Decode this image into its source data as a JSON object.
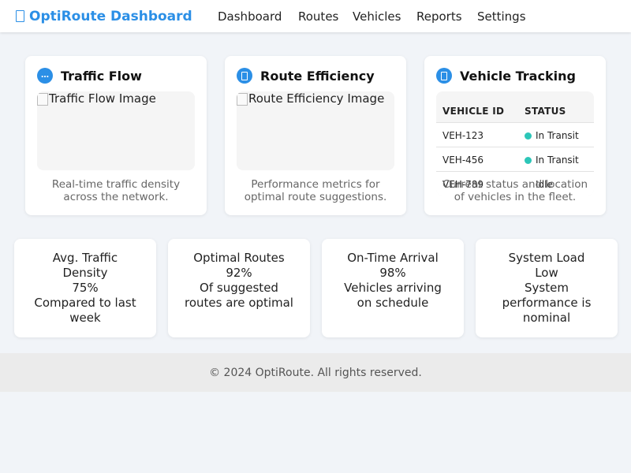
{
  "header": {
    "brand": "OptiRoute Dashboard",
    "nav": [
      "Dashboard",
      "Routes",
      "Vehicles",
      "Reports",
      "Settings"
    ]
  },
  "cards": {
    "traffic": {
      "icon": "…",
      "title": "Traffic Flow",
      "image_alt": "Traffic Flow Image",
      "description": "Real-time traffic density across the network."
    },
    "route": {
      "title": "Route Efficiency",
      "image_alt": "Route Efficiency Image",
      "description": "Performance metrics for optimal route suggestions."
    },
    "vehicle": {
      "title": "Vehicle Tracking",
      "table": {
        "headers": [
          "VEHICLE ID",
          "STATUS"
        ],
        "rows": [
          {
            "id": "VEH-123",
            "status": "In Transit"
          },
          {
            "id": "VEH-456",
            "status": "In Transit"
          },
          {
            "id": "VEH-789",
            "status": "Idle"
          }
        ]
      },
      "description": "Current status and location of vehicles in the fleet."
    }
  },
  "stats": [
    {
      "title": "Avg. Traffic Density",
      "value": "75%",
      "note": "Compared to last week"
    },
    {
      "title": "Optimal Routes",
      "value": "92%",
      "note": "Of suggested routes are optimal"
    },
    {
      "title": "On-Time Arrival",
      "value": "98%",
      "note": "Vehicles arriving on schedule"
    },
    {
      "title": "System Load",
      "value": "Low",
      "note": "System performance is nominal"
    }
  ],
  "footer": {
    "text": "© 2024 OptiRoute. All rights reserved."
  },
  "colors": {
    "accent": "#2b8fe6",
    "status_transit": "#2cc6b8",
    "background": "#f1f4f8"
  }
}
